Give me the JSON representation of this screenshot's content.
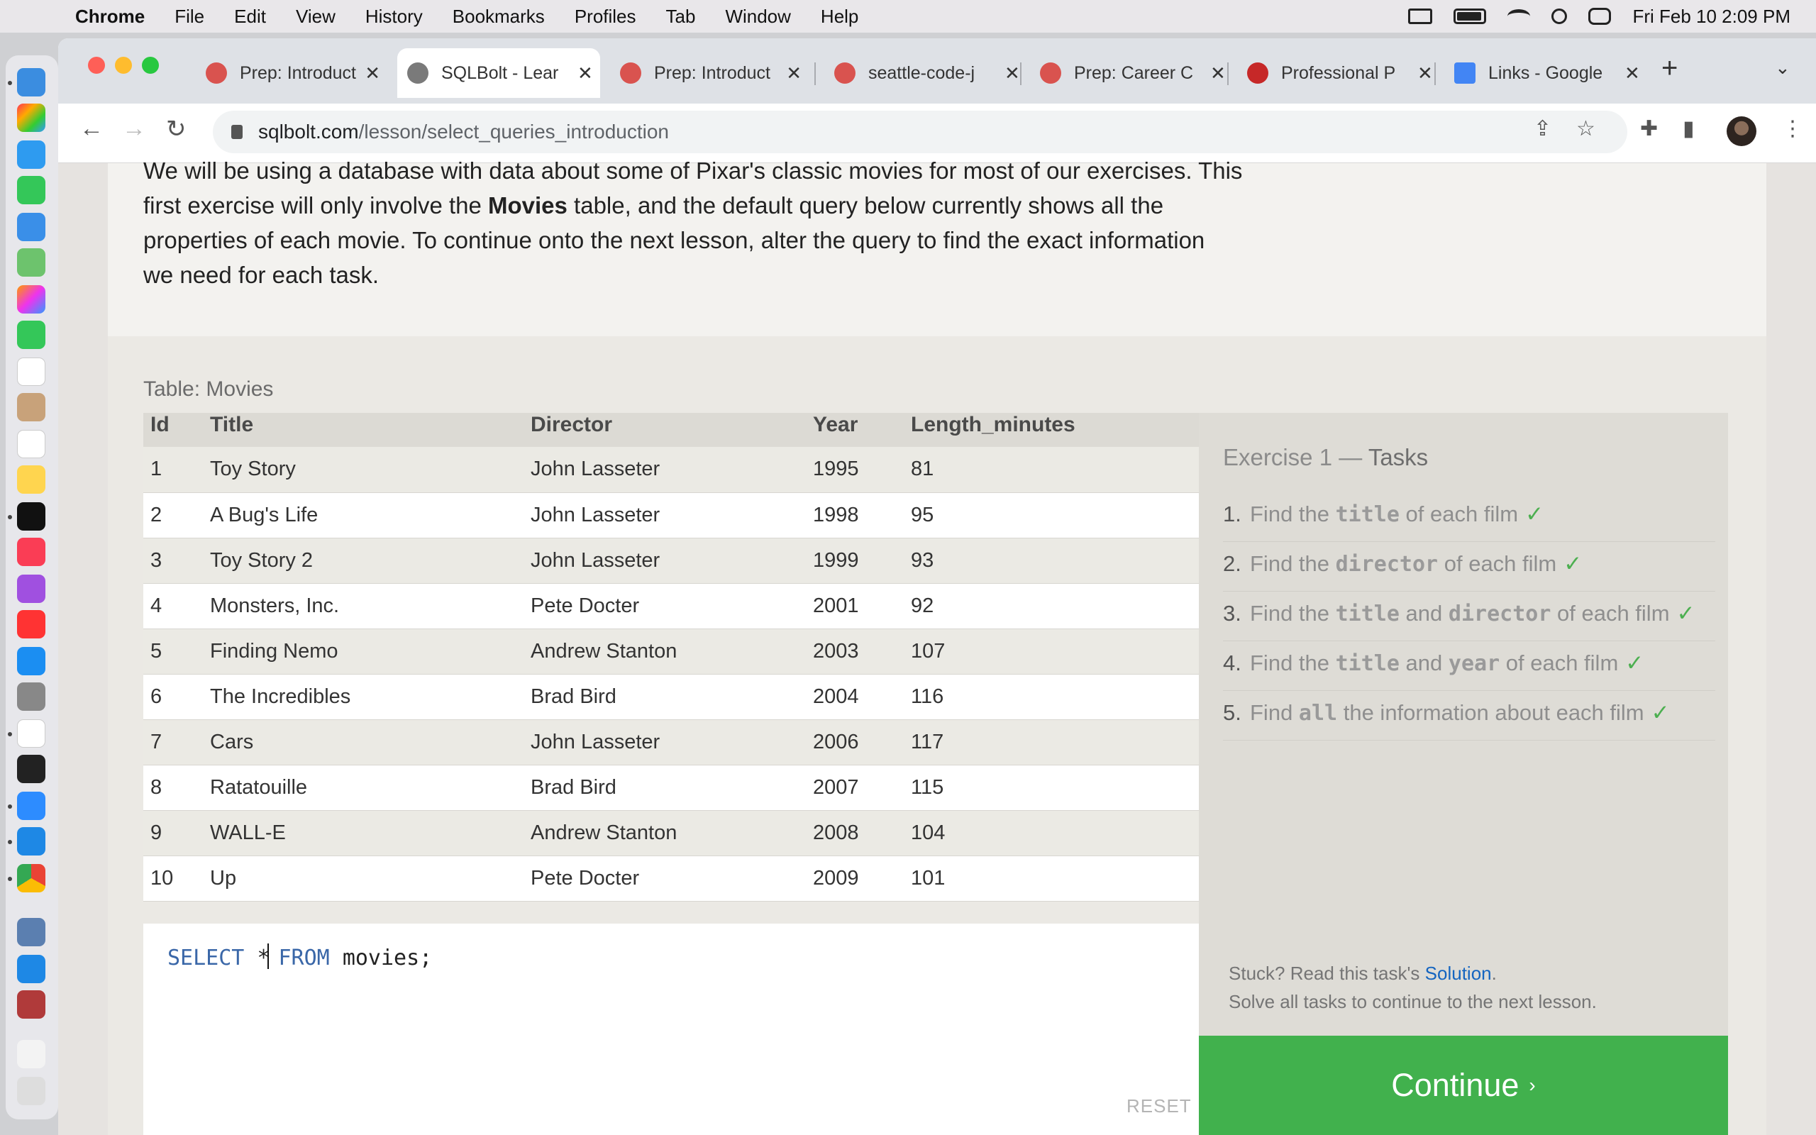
{
  "menubar": {
    "app": "Chrome",
    "items": [
      "File",
      "Edit",
      "View",
      "History",
      "Bookmarks",
      "Profiles",
      "Tab",
      "Window",
      "Help"
    ],
    "clock": "Fri Feb 10  2:09 PM"
  },
  "tabs": [
    {
      "title": "Prep: Introduct",
      "favicon_color": "#d9534f",
      "active": false
    },
    {
      "title": "SQLBolt - Lear",
      "favicon_color": "#7a7a7a",
      "active": true
    },
    {
      "title": "Prep: Introduct",
      "favicon_color": "#d9534f",
      "active": false
    },
    {
      "title": "seattle-code-j",
      "favicon_color": "#d9534f",
      "active": false
    },
    {
      "title": "Prep: Career C",
      "favicon_color": "#d9534f",
      "active": false
    },
    {
      "title": "Professional P",
      "favicon_color": "#c62828",
      "active": false
    },
    {
      "title": "Links - Google",
      "favicon_color": "#4285f4",
      "active": false
    }
  ],
  "address": {
    "domain": "sqlbolt.com",
    "path": "/lesson/select_queries_introduction"
  },
  "intro": {
    "line1": "We will be using a database with data about some of Pixar's classic movies for most of our exercises. This",
    "line2_pre": "first exercise will only involve the ",
    "line2_bold": "Movies",
    "line2_post": " table, and the default query below currently shows all the",
    "line3": "properties of each movie. To continue onto the next lesson, alter the query to find the exact information",
    "line4": "we need for each task."
  },
  "table": {
    "caption": "Table: Movies",
    "columns": [
      "Id",
      "Title",
      "Director",
      "Year",
      "Length_minutes"
    ],
    "rows": [
      [
        "1",
        "Toy Story",
        "John Lasseter",
        "1995",
        "81"
      ],
      [
        "2",
        "A Bug's Life",
        "John Lasseter",
        "1998",
        "95"
      ],
      [
        "3",
        "Toy Story 2",
        "John Lasseter",
        "1999",
        "93"
      ],
      [
        "4",
        "Monsters, Inc.",
        "Pete Docter",
        "2001",
        "92"
      ],
      [
        "5",
        "Finding Nemo",
        "Andrew Stanton",
        "2003",
        "107"
      ],
      [
        "6",
        "The Incredibles",
        "Brad Bird",
        "2004",
        "116"
      ],
      [
        "7",
        "Cars",
        "John Lasseter",
        "2006",
        "117"
      ],
      [
        "8",
        "Ratatouille",
        "Brad Bird",
        "2007",
        "115"
      ],
      [
        "9",
        "WALL-E",
        "Andrew Stanton",
        "2008",
        "104"
      ],
      [
        "10",
        "Up",
        "Pete Docter",
        "2009",
        "101"
      ]
    ]
  },
  "editor": {
    "kw_select": "SELECT",
    "star": "*",
    "kw_from": "FROM",
    "table_name": "movies;",
    "reset_label": "RESET"
  },
  "tasks": {
    "title_pre": "Exercise 1 — ",
    "title_hl": "Tasks",
    "items": [
      {
        "num": "1.",
        "parts": [
          "Find the ",
          "title",
          " of each film"
        ]
      },
      {
        "num": "2.",
        "parts": [
          "Find the ",
          "director",
          " of each film"
        ]
      },
      {
        "num": "3.",
        "parts": [
          "Find the ",
          "title",
          " and ",
          "director",
          " of each film"
        ]
      },
      {
        "num": "4.",
        "parts": [
          "Find the ",
          "title",
          " and ",
          "year",
          " of each film"
        ]
      },
      {
        "num": "5.",
        "parts": [
          "Find ",
          "all",
          " the information about each film"
        ]
      }
    ],
    "check": "✓",
    "help_pre": "Stuck? Read this task's ",
    "help_link": "Solution",
    "help_post": ".",
    "help_line2": "Solve all tasks to continue to the next lesson.",
    "continue_label": "Continue",
    "continue_arrow": "›"
  }
}
